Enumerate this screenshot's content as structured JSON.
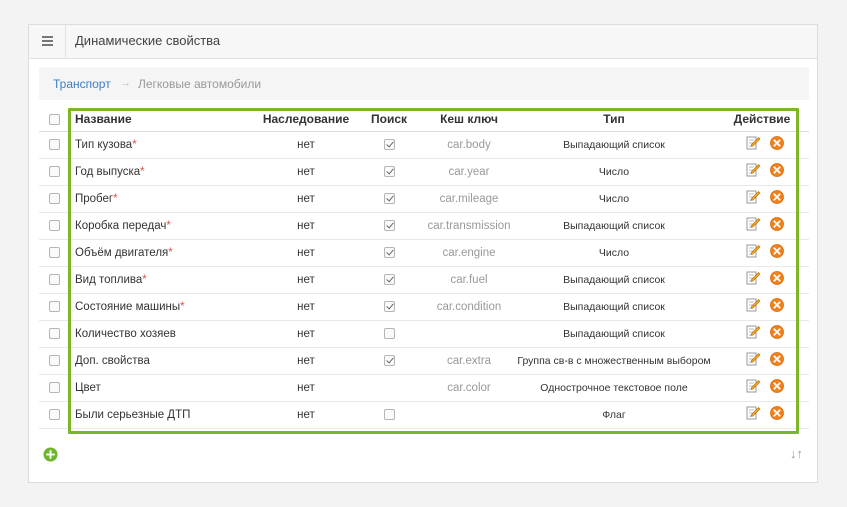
{
  "header": {
    "title": "Динамические свойства",
    "menu_icon": "hamburger-icon"
  },
  "breadcrumb": {
    "parent": "Транспорт",
    "separator": "→",
    "current": "Легковые автомобили"
  },
  "table": {
    "columns": {
      "name": "Название",
      "inheritance": "Наследование",
      "search": "Поиск",
      "cache_key": "Кеш ключ",
      "type": "Тип",
      "action": "Действие"
    },
    "rows": [
      {
        "name": "Тип кузова",
        "required": "*",
        "inheritance": "нет",
        "search": true,
        "cache_key": "car.body",
        "type": "Выпадающий список"
      },
      {
        "name": "Год выпуска",
        "required": "*",
        "inheritance": "нет",
        "search": true,
        "cache_key": "car.year",
        "type": "Число"
      },
      {
        "name": "Пробег",
        "required": "*",
        "inheritance": "нет",
        "search": true,
        "cache_key": "car.mileage",
        "type": "Число"
      },
      {
        "name": "Коробка передач",
        "required": "*",
        "inheritance": "нет",
        "search": true,
        "cache_key": "car.transmission",
        "type": "Выпадающий список"
      },
      {
        "name": "Объём двигателя",
        "required": "*",
        "inheritance": "нет",
        "search": true,
        "cache_key": "car.engine",
        "type": "Число"
      },
      {
        "name": "Вид топлива",
        "required": "*",
        "inheritance": "нет",
        "search": true,
        "cache_key": "car.fuel",
        "type": "Выпадающий список"
      },
      {
        "name": "Состояние машины",
        "required": "*",
        "inheritance": "нет",
        "search": true,
        "cache_key": "car.condition",
        "type": "Выпадающий список"
      },
      {
        "name": "Количество хозяев",
        "required": "",
        "inheritance": "нет",
        "search": false,
        "cache_key": "",
        "type": "Выпадающий список"
      },
      {
        "name": "Доп. свойства",
        "required": "",
        "inheritance": "нет",
        "search": true,
        "cache_key": "car.extra",
        "type": "Группа св-в с множественным выбором"
      },
      {
        "name": "Цвет",
        "required": "",
        "inheritance": "нет",
        "search": null,
        "cache_key": "car.color",
        "type": "Однострочное текстовое поле"
      },
      {
        "name": "Были серьезные ДТП",
        "required": "",
        "inheritance": "нет",
        "search": false,
        "cache_key": "",
        "type": "Флаг"
      }
    ]
  },
  "footer": {
    "add_icon": "add-circle-icon",
    "sort_label": "↓↑"
  },
  "colors": {
    "accent_green": "#7ab829",
    "link_blue": "#3d7ec8",
    "delete_orange": "#f0821e",
    "required_red": "#d9534f"
  }
}
